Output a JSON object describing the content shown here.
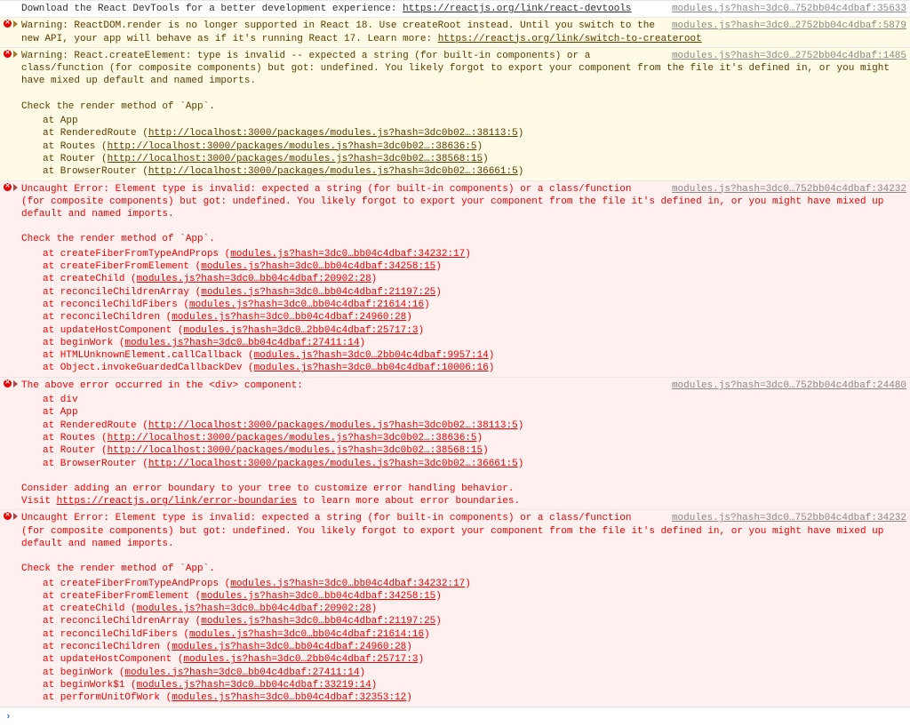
{
  "rows": [
    {
      "type": "info",
      "icon": "",
      "disclose": false,
      "source": "modules.js?hash=3dc0…752bb04c4dbaf:35633",
      "html": "Download the React DevTools for a better development experience: <a>https://reactjs.org/link/react-devtools</a>"
    },
    {
      "type": "warn",
      "icon": "err",
      "disclose": true,
      "source": "modules.js?hash=3dc0…2752bb04c4dbaf:5879",
      "html": "Warning: ReactDOM.render is no longer supported in React 18. Use createRoot instead. Until you switch to the new API, your app will behave as if it's running React 17. Learn more: <a>https://reactjs.org/link/switch-to-createroot</a>"
    },
    {
      "type": "warn",
      "icon": "err",
      "disclose": true,
      "source": "modules.js?hash=3dc0…2752bb04c4dbaf:1485",
      "html": "Warning: React.createElement: type is invalid -- expected a string (for built-in components) or a class/function (for composite components) but got: undefined. You likely forgot to export your component from the file it's defined in, or you might have mixed up default and named imports.",
      "extraHtml": "Check the render method of `App`.",
      "stack": [
        {
          "fn": "at App",
          "link": ""
        },
        {
          "fn": "at RenderedRoute (",
          "link": "http://localhost:3000/packages/modules.js?hash=3dc0b02…:38113:5",
          "suf": ")"
        },
        {
          "fn": "at Routes (",
          "link": "http://localhost:3000/packages/modules.js?hash=3dc0b02…:38636:5",
          "suf": ")"
        },
        {
          "fn": "at Router (",
          "link": "http://localhost:3000/packages/modules.js?hash=3dc0b02…:38568:15",
          "suf": ")"
        },
        {
          "fn": "at BrowserRouter (",
          "link": "http://localhost:3000/packages/modules.js?hash=3dc0b02…:36661:5",
          "suf": ")"
        }
      ]
    },
    {
      "type": "error",
      "icon": "err",
      "disclose": true,
      "source": "modules.js?hash=3dc0…752bb04c4dbaf:34232",
      "html": "Uncaught Error: Element type is invalid: expected a string (for built-in components) or a class/function (for composite components) but got: undefined. You likely forgot to export your component from the file it's defined in, or you might have mixed up default and named imports.",
      "extraHtml": "Check the render method of `App`.",
      "stack": [
        {
          "fn": "at createFiberFromTypeAndProps (",
          "link": "modules.js?hash=3dc0…bb04c4dbaf:34232:17",
          "suf": ")"
        },
        {
          "fn": "at createFiberFromElement (",
          "link": "modules.js?hash=3dc0…bb04c4dbaf:34258:15",
          "suf": ")"
        },
        {
          "fn": "at createChild (",
          "link": "modules.js?hash=3dc0…bb04c4dbaf:20902:28",
          "suf": ")"
        },
        {
          "fn": "at reconcileChildrenArray (",
          "link": "modules.js?hash=3dc0…bb04c4dbaf:21197:25",
          "suf": ")"
        },
        {
          "fn": "at reconcileChildFibers (",
          "link": "modules.js?hash=3dc0…bb04c4dbaf:21614:16",
          "suf": ")"
        },
        {
          "fn": "at reconcileChildren (",
          "link": "modules.js?hash=3dc0…bb04c4dbaf:24960:28",
          "suf": ")"
        },
        {
          "fn": "at updateHostComponent (",
          "link": "modules.js?hash=3dc0…2bb04c4dbaf:25717:3",
          "suf": ")"
        },
        {
          "fn": "at beginWork (",
          "link": "modules.js?hash=3dc0…bb04c4dbaf:27411:14",
          "suf": ")"
        },
        {
          "fn": "at HTMLUnknownElement.callCallback (",
          "link": "modules.js?hash=3dc0…2bb04c4dbaf:9957:14",
          "suf": ")"
        },
        {
          "fn": "at Object.invokeGuardedCallbackDev (",
          "link": "modules.js?hash=3dc0…bb04c4dbaf:10006:16",
          "suf": ")"
        }
      ]
    },
    {
      "type": "error",
      "icon": "err",
      "disclose": true,
      "source": "modules.js?hash=3dc0…752bb04c4dbaf:24480",
      "html": "The above error occurred in the &lt;div&gt; component:",
      "stack": [
        {
          "fn": "at div",
          "link": ""
        },
        {
          "fn": "at App",
          "link": ""
        },
        {
          "fn": "at RenderedRoute (",
          "link": "http://localhost:3000/packages/modules.js?hash=3dc0b02…:38113:5",
          "suf": ")"
        },
        {
          "fn": "at Routes (",
          "link": "http://localhost:3000/packages/modules.js?hash=3dc0b02…:38636:5",
          "suf": ")"
        },
        {
          "fn": "at Router (",
          "link": "http://localhost:3000/packages/modules.js?hash=3dc0b02…:38568:15",
          "suf": ")"
        },
        {
          "fn": "at BrowserRouter (",
          "link": "http://localhost:3000/packages/modules.js?hash=3dc0b02…:36661:5",
          "suf": ")"
        }
      ],
      "trailerHtml": "Consider adding an error boundary to your tree to customize error handling behavior.<br>Visit <a>https://reactjs.org/link/error-boundaries</a> to learn more about error boundaries."
    },
    {
      "type": "error",
      "icon": "err",
      "disclose": true,
      "source": "modules.js?hash=3dc0…752bb04c4dbaf:34232",
      "html": "Uncaught Error: Element type is invalid: expected a string (for built-in components) or a class/function (for composite components) but got: undefined. You likely forgot to export your component from the file it's defined in, or you might have mixed up default and named imports.",
      "extraHtml": "Check the render method of `App`.",
      "stack": [
        {
          "fn": "at createFiberFromTypeAndProps (",
          "link": "modules.js?hash=3dc0…bb04c4dbaf:34232:17",
          "suf": ")"
        },
        {
          "fn": "at createFiberFromElement (",
          "link": "modules.js?hash=3dc0…bb04c4dbaf:34258:15",
          "suf": ")"
        },
        {
          "fn": "at createChild (",
          "link": "modules.js?hash=3dc0…bb04c4dbaf:20902:28",
          "suf": ")"
        },
        {
          "fn": "at reconcileChildrenArray (",
          "link": "modules.js?hash=3dc0…bb04c4dbaf:21197:25",
          "suf": ")"
        },
        {
          "fn": "at reconcileChildFibers (",
          "link": "modules.js?hash=3dc0…bb04c4dbaf:21614:16",
          "suf": ")"
        },
        {
          "fn": "at reconcileChildren (",
          "link": "modules.js?hash=3dc0…bb04c4dbaf:24960:28",
          "suf": ")"
        },
        {
          "fn": "at updateHostComponent (",
          "link": "modules.js?hash=3dc0…2bb04c4dbaf:25717:3",
          "suf": ")"
        },
        {
          "fn": "at beginWork (",
          "link": "modules.js?hash=3dc0…bb04c4dbaf:27411:14",
          "suf": ")"
        },
        {
          "fn": "at beginWork$1 (",
          "link": "modules.js?hash=3dc0…bb04c4dbaf:33219:14",
          "suf": ")"
        },
        {
          "fn": "at performUnitOfWork (",
          "link": "modules.js?hash=3dc0…bb04c4dbaf:32353:12",
          "suf": ")"
        }
      ]
    }
  ],
  "prompt": "›"
}
